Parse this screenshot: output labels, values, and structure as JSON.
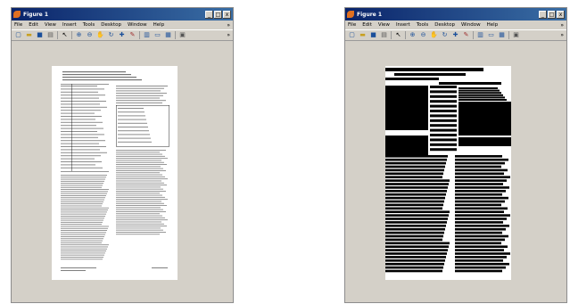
{
  "windows": [
    {
      "title": "Figure 1",
      "menus": [
        "File",
        "Edit",
        "View",
        "Insert",
        "Tools",
        "Desktop",
        "Window",
        "Help"
      ],
      "variant": "original"
    },
    {
      "title": "Figure 1",
      "menus": [
        "File",
        "Edit",
        "View",
        "Insert",
        "Tools",
        "Desktop",
        "Window",
        "Help"
      ],
      "variant": "binarized"
    }
  ],
  "window_controls": {
    "minimize": "_",
    "maximize": "□",
    "close": "x"
  },
  "overflow_glyph": "»",
  "colors": {
    "titlebar": "#0a246a",
    "canvas": "#d4d0c8",
    "ink": "#000000",
    "page": "#ffffff"
  },
  "toolbar_icons": [
    "new-file-icon",
    "open-folder-icon",
    "save-icon",
    "print-icon",
    "pointer-icon",
    "zoom-in-icon",
    "zoom-out-icon",
    "pan-icon",
    "rotate-icon",
    "data-cursor-icon",
    "brush-icon",
    "colorbar-icon",
    "legend-icon",
    "plot-tools-icon"
  ]
}
